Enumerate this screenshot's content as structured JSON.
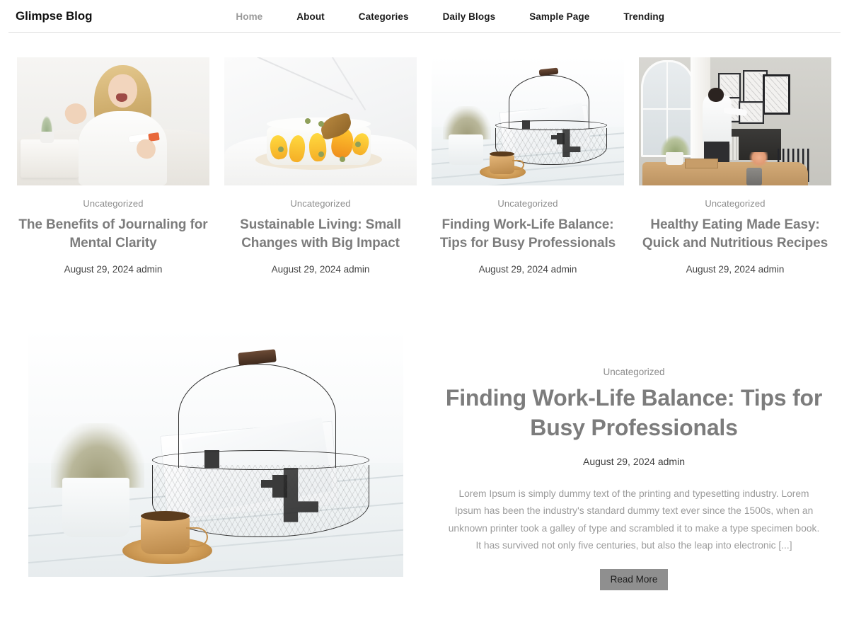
{
  "header": {
    "site_title": "Glimpse Blog",
    "nav": [
      {
        "label": "Home",
        "active": true
      },
      {
        "label": "About",
        "active": false
      },
      {
        "label": "Categories",
        "active": false
      },
      {
        "label": "Daily Blogs",
        "active": false
      },
      {
        "label": "Sample Page",
        "active": false
      },
      {
        "label": "Trending",
        "active": false
      }
    ]
  },
  "cards": [
    {
      "category": "Uncategorized",
      "title": "The Benefits of Journaling for Mental Clarity",
      "meta": "August 29, 2024 admin",
      "date": "August 29, 2024",
      "author": "admin",
      "image_name": "woman-celebrating-in-bright-bedroom-photo"
    },
    {
      "category": "Uncategorized",
      "title": "Sustainable Living: Small Changes with Big Impact",
      "meta": "August 29, 2024 admin",
      "date": "August 29, 2024",
      "author": "admin",
      "image_name": "white-cake-with-yellow-petals-photo"
    },
    {
      "category": "Uncategorized",
      "title": "Finding Work-Life Balance: Tips for Busy Professionals",
      "meta": "August 29, 2024 admin",
      "date": "August 29, 2024",
      "author": "admin",
      "image_name": "wire-basket-newspapers-copper-cup-photo"
    },
    {
      "category": "Uncategorized",
      "title": "Healthy Eating Made Easy: Quick and Nutritious Recipes",
      "meta": "August 29, 2024 admin",
      "date": "August 29, 2024",
      "author": "admin",
      "image_name": "man-hanging-picture-frames-photo"
    }
  ],
  "featured": {
    "category": "Uncategorized",
    "title": "Finding Work-Life Balance: Tips for Busy Professionals",
    "meta": "August 29, 2024 admin",
    "date": "August 29, 2024",
    "author": "admin",
    "excerpt": "Lorem Ipsum is simply dummy text of the printing and typesetting industry. Lorem Ipsum has been the industry's standard dummy text ever since the 1500s, when an unknown printer took a galley of type and scrambled it to make a type specimen book. It has survived not only five centuries, but also the leap into electronic [...]",
    "read_more_label": "Read More",
    "image_name": "wire-basket-newspapers-copper-cup-photo"
  },
  "colors": {
    "page_background": "#ffffff",
    "site_title": "#111111",
    "nav_link": "#1b1b1b",
    "nav_link_active": "#9a9a9a",
    "post_title": "#7c7c7c",
    "category_text": "#8d8d8d",
    "meta_text": "#444444",
    "excerpt_text": "#9b9b9b",
    "button_background": "#8f8f8f",
    "button_text": "#1e1e1e",
    "header_border": "#dddddd"
  }
}
